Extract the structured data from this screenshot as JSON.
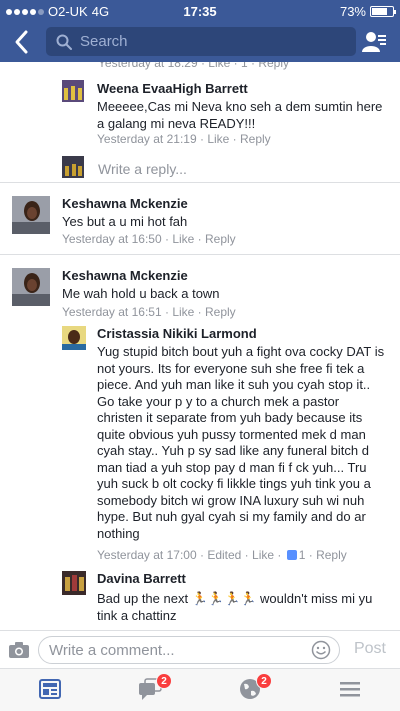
{
  "status_bar": {
    "carrier": "O2-UK",
    "network": "4G",
    "time": "17:35",
    "battery": "73%"
  },
  "nav": {
    "search_placeholder": "Search"
  },
  "partial_meta": "Yesterday at 18:29 · Like · 1 · Reply",
  "comments": [
    {
      "name": "Weena EvaaHigh Barrett",
      "text": "Meeeee,Cas mi Neva kno seh  a dem sumtin here a galang mi neva  READY!!!",
      "time": "Yesterday at 21:19",
      "like": "Like",
      "reply": "Reply"
    },
    {
      "name": "Keshawna Mckenzie",
      "text": "Yes but a u mi hot fah",
      "time": "Yesterday at 16:50",
      "like": "Like",
      "reply": "Reply"
    },
    {
      "name": "Keshawna Mckenzie",
      "text": "Me wah hold u back a town",
      "time": "Yesterday at 16:51",
      "like": "Like",
      "reply": "Reply"
    },
    {
      "name": "Cristassia Nikiki Larmond",
      "text": "Yug stupid bitch bout yuh a fight ova cocky DAT is not yours. Its for everyone suh she free fi tek  a piece. And yuh man like it suh you cyah stop it.. Go take your p     y to a church mek a pastor christen it separate from yuh bady because its quite obvious yuh pussy tormented mek d man cyah stay.. Yuh p    sy sad like any funeral bitch d man tiad a yuh stop pay d man fi f  ck yuh... Tru  yuh suck b olt cocky fi likkle tings yuh tink you a somebody bitch wi grow INA luxury suh wi nuh hype. But nuh gyal cyah si my family and do ar nothing",
      "time": "Yesterday at 17:00",
      "edited": "Edited",
      "like": "Like",
      "like_count": "1",
      "reply": "Reply"
    },
    {
      "name": "Davina Barrett",
      "text": "Bad up the next  🏃🏃🏃🏃  wouldn't miss mi yu tink a chattinz"
    }
  ],
  "reply_placeholder": "Write a reply...",
  "composer": {
    "placeholder": "Write a comment...",
    "post_label": "Post"
  },
  "tabs": [
    {
      "icon": "news-feed-icon",
      "badge": ""
    },
    {
      "icon": "messages-icon",
      "badge": "2"
    },
    {
      "icon": "notifications-globe-icon",
      "badge": "2"
    },
    {
      "icon": "menu-icon",
      "badge": ""
    }
  ],
  "colors": {
    "brand": "#3b5998",
    "meta": "#90949c",
    "link": "#365899",
    "badge": "#fa3e3e"
  }
}
